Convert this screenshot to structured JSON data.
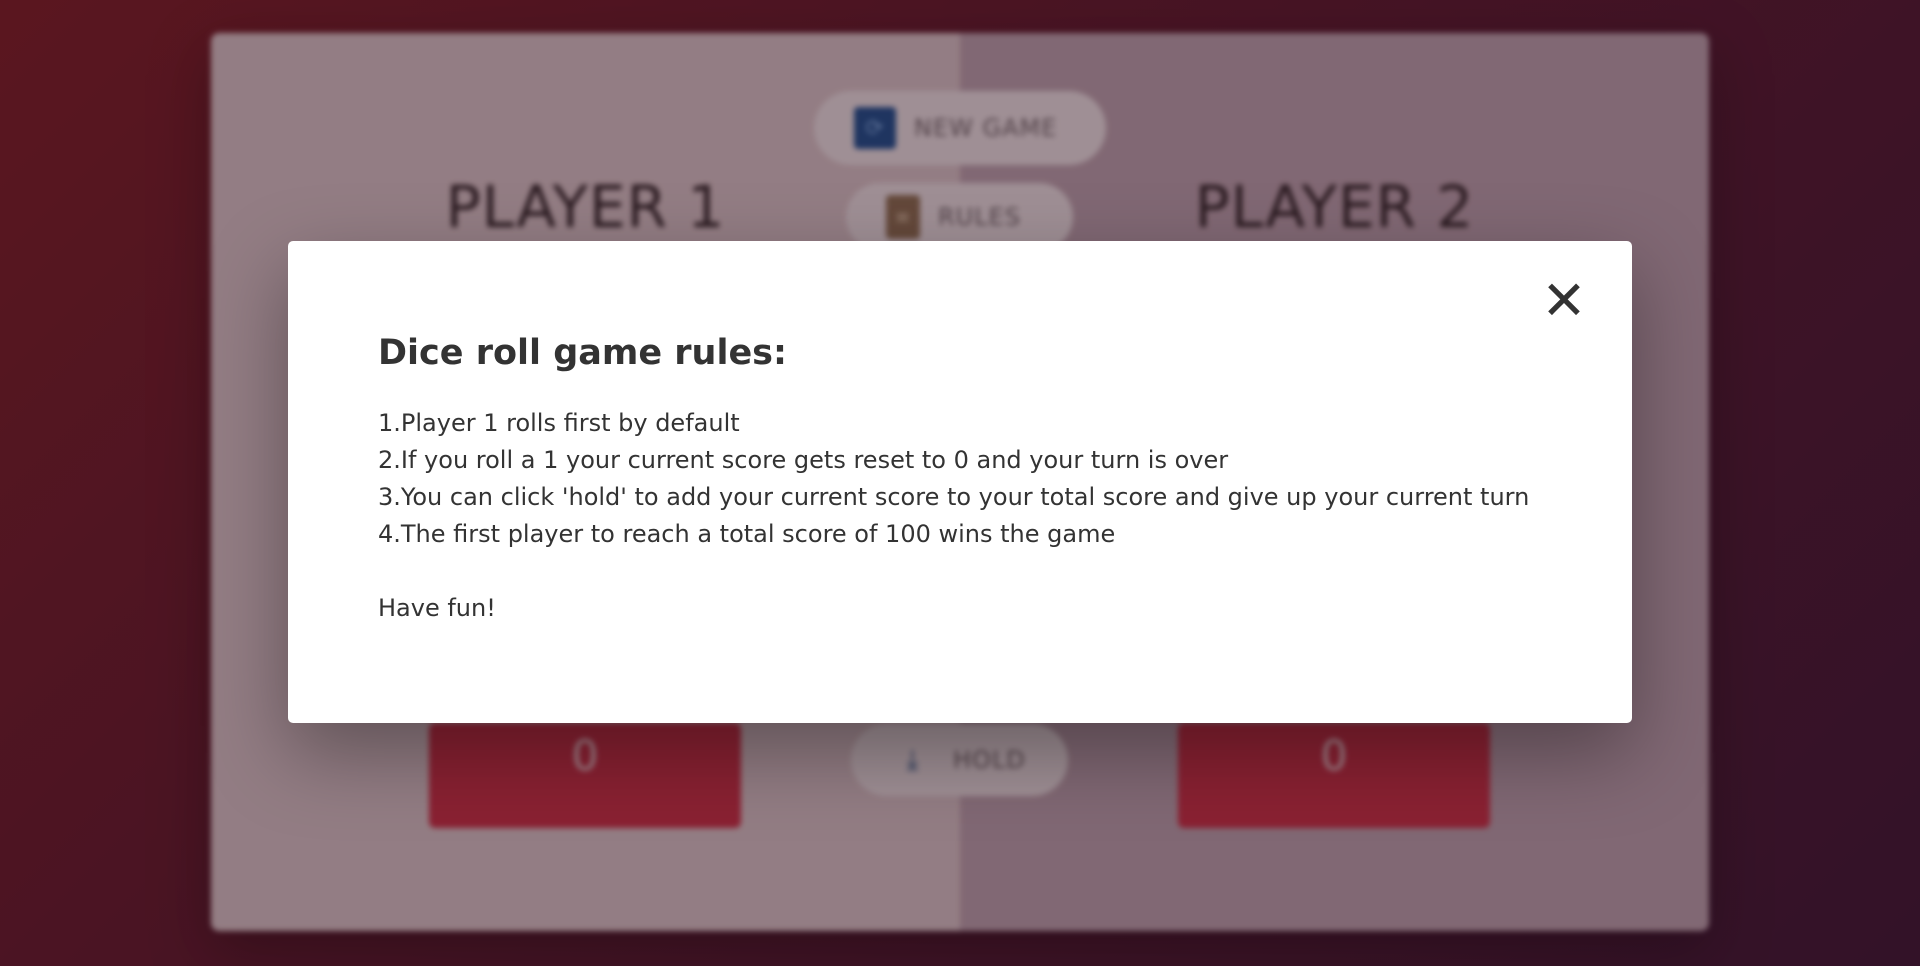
{
  "background": {
    "new_game_label": "NEW GAME",
    "rules_label": "RULES",
    "hold_label": "HOLD",
    "players": [
      {
        "name": "PLAYER 1",
        "current": "0"
      },
      {
        "name": "PLAYER 2",
        "current": "0"
      }
    ]
  },
  "modal": {
    "title": "Dice roll game rules:",
    "close_label": "✕",
    "rules": [
      "1.Player 1 rolls first by default",
      "2.If you roll a 1 your current score gets reset to 0 and your turn is over",
      "3.You can click 'hold' to add your current score to your total score and give up your current turn",
      "4.The first player to reach a total score of 100 wins the game"
    ],
    "footer": "Have fun!"
  },
  "colors": {
    "modal_bg": "#ffffff",
    "text": "#333333",
    "current_box": "#c72f45",
    "new_game_icon": "#1a4f8f"
  },
  "icons": {
    "new_game": "refresh-icon",
    "rules": "scroll-icon",
    "hold": "download-icon",
    "close": "close-icon"
  }
}
